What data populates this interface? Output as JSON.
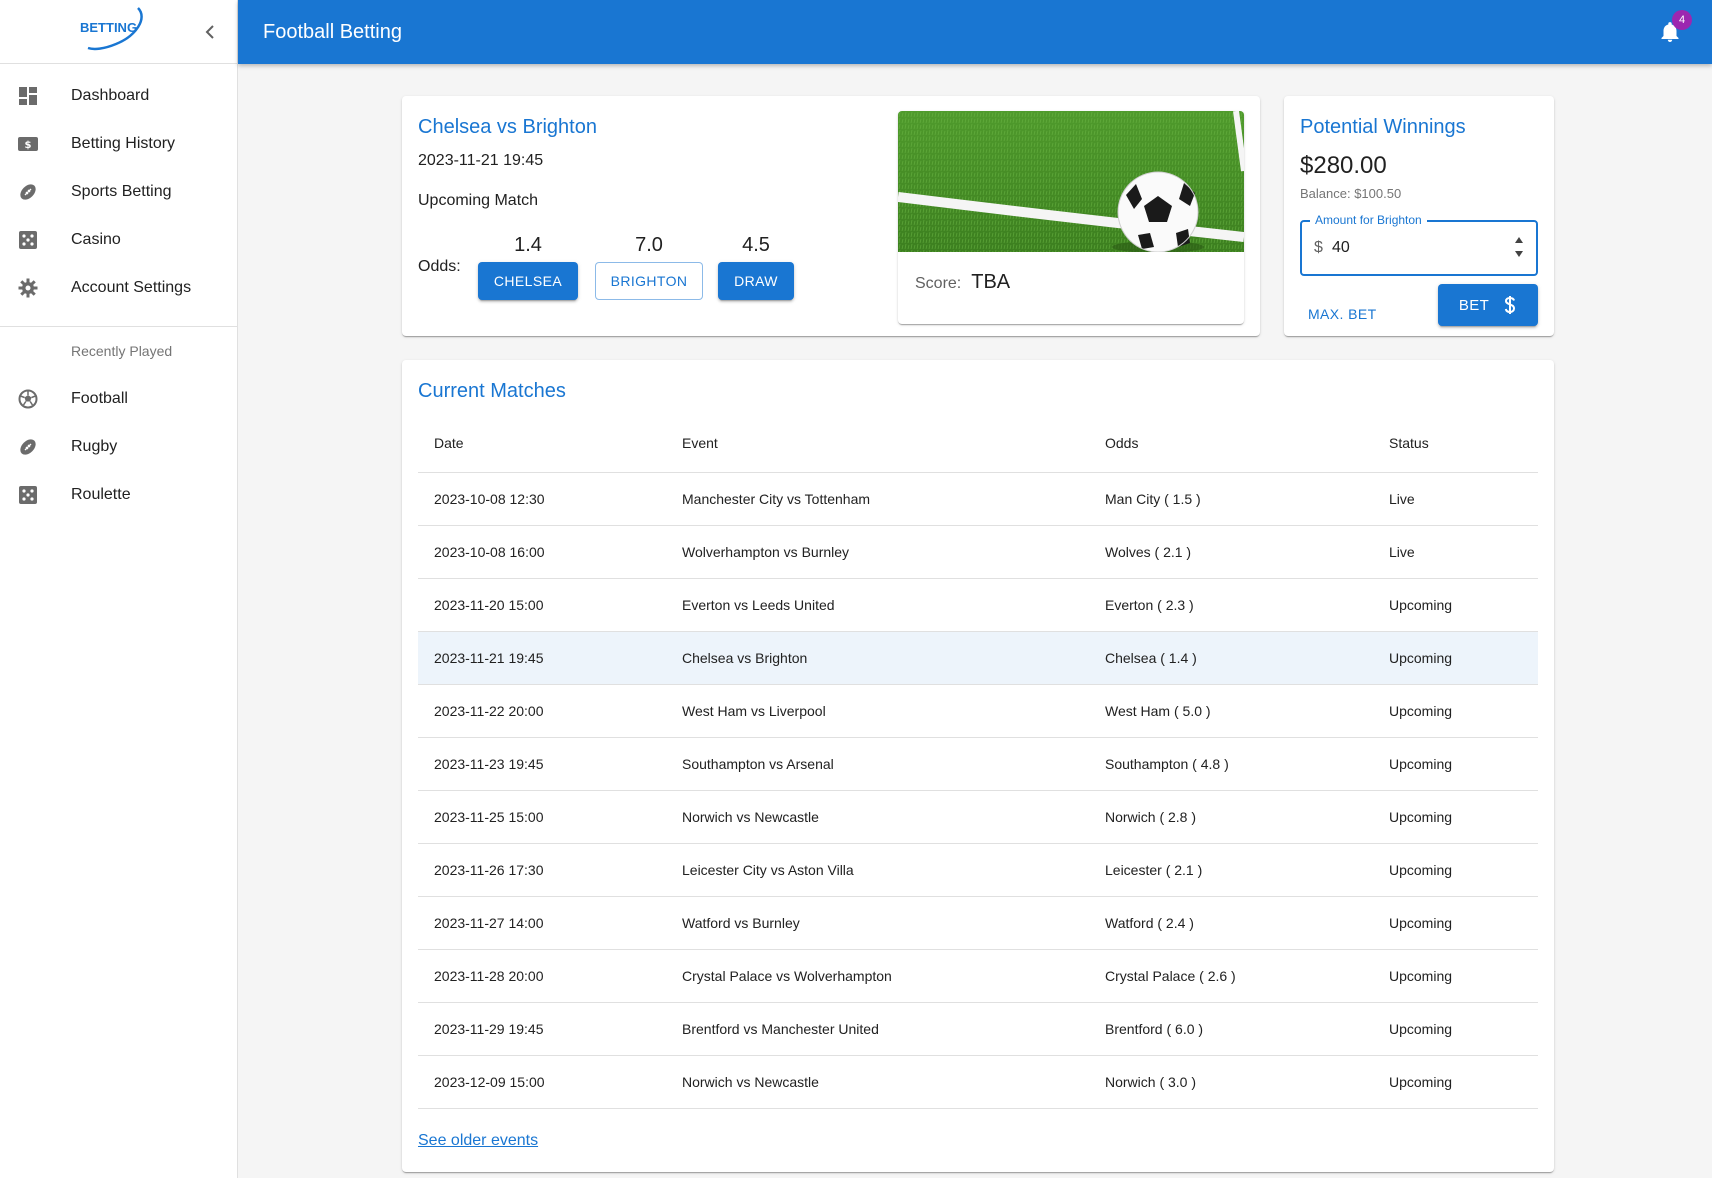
{
  "brand": {
    "logo_text": "BETTING"
  },
  "sidebar": {
    "items": [
      {
        "label": "Dashboard",
        "icon": "dashboard-icon"
      },
      {
        "label": "Betting History",
        "icon": "money-icon"
      },
      {
        "label": "Sports Betting",
        "icon": "football-icon"
      },
      {
        "label": "Casino",
        "icon": "dice-icon"
      },
      {
        "label": "Account Settings",
        "icon": "gear-icon"
      }
    ],
    "recent_header": "Recently Played",
    "recent": [
      {
        "label": "Football",
        "icon": "soccer-ball-icon"
      },
      {
        "label": "Rugby",
        "icon": "rugby-ball-icon"
      },
      {
        "label": "Roulette",
        "icon": "dice-icon"
      }
    ]
  },
  "appbar": {
    "title": "Football Betting",
    "notification_count": "4"
  },
  "match": {
    "title": "Chelsea vs Brighton",
    "datetime": "2023-11-21 19:45",
    "status": "Upcoming Match",
    "odds_label": "Odds:",
    "options": [
      {
        "odds": "1.4",
        "label": "CHELSEA",
        "selected": false
      },
      {
        "odds": "7.0",
        "label": "BRIGHTON",
        "selected": true
      },
      {
        "odds": "4.5",
        "label": "DRAW",
        "selected": false
      }
    ],
    "score_label": "Score:",
    "score_value": "TBA"
  },
  "winnings": {
    "title": "Potential Winnings",
    "amount": "$280.00",
    "balance": "Balance: $100.50",
    "field_label": "Amount for Brighton",
    "currency": "$",
    "field_value": "40",
    "max_bet_label": "MAX. BET",
    "bet_label": "BET",
    "bet_icon": "dollar-icon"
  },
  "matches": {
    "title": "Current Matches",
    "columns": [
      "Date",
      "Event",
      "Odds",
      "Status"
    ],
    "rows": [
      {
        "date": "2023-10-08 12:30",
        "event": "Manchester City vs Tottenham",
        "odds": "Man City ( 1.5 )",
        "status": "Live"
      },
      {
        "date": "2023-10-08 16:00",
        "event": "Wolverhampton vs Burnley",
        "odds": "Wolves ( 2.1 )",
        "status": "Live"
      },
      {
        "date": "2023-11-20 15:00",
        "event": "Everton vs Leeds United",
        "odds": "Everton ( 2.3 )",
        "status": "Upcoming"
      },
      {
        "date": "2023-11-21 19:45",
        "event": "Chelsea vs Brighton",
        "odds": "Chelsea ( 1.4 )",
        "status": "Upcoming",
        "selected": true
      },
      {
        "date": "2023-11-22 20:00",
        "event": "West Ham vs Liverpool",
        "odds": "West Ham ( 5.0 )",
        "status": "Upcoming"
      },
      {
        "date": "2023-11-23 19:45",
        "event": "Southampton vs Arsenal",
        "odds": "Southampton ( 4.8 )",
        "status": "Upcoming"
      },
      {
        "date": "2023-11-25 15:00",
        "event": "Norwich vs Newcastle",
        "odds": "Norwich ( 2.8 )",
        "status": "Upcoming"
      },
      {
        "date": "2023-11-26 17:30",
        "event": "Leicester City vs Aston Villa",
        "odds": "Leicester ( 2.1 )",
        "status": "Upcoming"
      },
      {
        "date": "2023-11-27 14:00",
        "event": "Watford vs Burnley",
        "odds": "Watford ( 2.4 )",
        "status": "Upcoming"
      },
      {
        "date": "2023-11-28 20:00",
        "event": "Crystal Palace vs Wolverhampton",
        "odds": "Crystal Palace ( 2.6 )",
        "status": "Upcoming"
      },
      {
        "date": "2023-11-29 19:45",
        "event": "Brentford vs Manchester United",
        "odds": "Brentford ( 6.0 )",
        "status": "Upcoming"
      },
      {
        "date": "2023-12-09 15:00",
        "event": "Norwich vs Newcastle",
        "odds": "Norwich ( 3.0 )",
        "status": "Upcoming"
      }
    ],
    "older_link": "See older events"
  },
  "colors": {
    "primary": "#1976d2",
    "badge": "#9c27b0",
    "selected_row": "#edf4fb",
    "icon": "#6b6b6b"
  }
}
